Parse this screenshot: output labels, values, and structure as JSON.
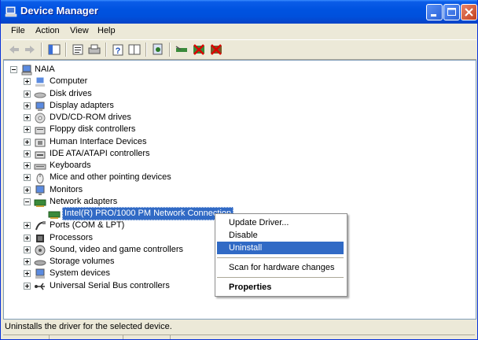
{
  "window": {
    "title": "Device Manager",
    "app_icon": "device-manager-icon"
  },
  "menu": [
    "File",
    "Action",
    "View",
    "Help"
  ],
  "toolbar": [
    "back-icon",
    "forward-icon",
    "up-tree-icon",
    "properties-icon",
    "print-icon",
    "help-icon",
    "show-hide-tree-icon",
    "scan-hardware-icon",
    "update-driver-icon",
    "uninstall-icon",
    "disable-icon"
  ],
  "tree": {
    "root": "NAIA",
    "categories": [
      {
        "label": "Computer",
        "icon": "computer-icon"
      },
      {
        "label": "Disk drives",
        "icon": "disk-drive-icon"
      },
      {
        "label": "Display adapters",
        "icon": "display-adapter-icon"
      },
      {
        "label": "DVD/CD-ROM drives",
        "icon": "dvd-drive-icon"
      },
      {
        "label": "Floppy disk controllers",
        "icon": "floppy-controller-icon"
      },
      {
        "label": "Human Interface Devices",
        "icon": "hid-icon"
      },
      {
        "label": "IDE ATA/ATAPI controllers",
        "icon": "ide-controller-icon"
      },
      {
        "label": "Keyboards",
        "icon": "keyboard-icon"
      },
      {
        "label": "Mice and other pointing devices",
        "icon": "mouse-icon"
      },
      {
        "label": "Monitors",
        "icon": "monitor-icon"
      },
      {
        "label": "Network adapters",
        "icon": "network-adapter-icon",
        "expanded": true
      },
      {
        "label": "Ports (COM & LPT)",
        "icon": "port-icon"
      },
      {
        "label": "Processors",
        "icon": "processor-icon"
      },
      {
        "label": "Sound, video and game controllers",
        "icon": "sound-icon"
      },
      {
        "label": "Storage volumes",
        "icon": "storage-icon"
      },
      {
        "label": "System devices",
        "icon": "system-device-icon"
      },
      {
        "label": "Universal Serial Bus controllers",
        "icon": "usb-icon"
      }
    ],
    "selected_child": "Intel(R) PRO/1000 PM Network Connection"
  },
  "context_menu": {
    "items": [
      "Update Driver...",
      "Disable",
      "Uninstall",
      "Scan for hardware changes",
      "Properties"
    ],
    "highlighted": "Uninstall"
  },
  "status_text": "Uninstalls the driver for the selected device.",
  "colors": {
    "title_blue": "#0053e0",
    "selection": "#316ac5",
    "chrome": "#ece9d8"
  }
}
